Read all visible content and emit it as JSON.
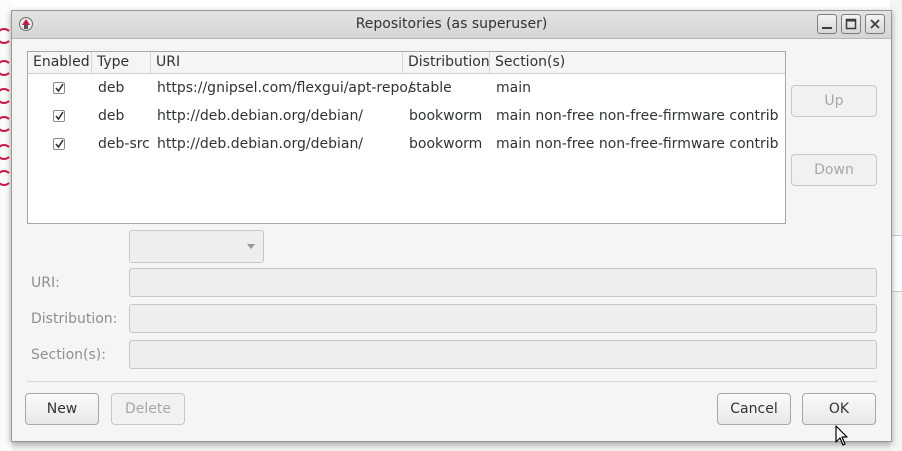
{
  "window": {
    "title": "Repositories (as superuser)"
  },
  "table": {
    "columns": [
      "Enabled",
      "Type",
      "URI",
      "Distribution",
      "Section(s)"
    ],
    "rows": [
      {
        "enabled": true,
        "type": "deb",
        "uri": "https://gnipsel.com/flexgui/apt-repo/",
        "distribution": "stable",
        "sections": "main"
      },
      {
        "enabled": true,
        "type": "deb",
        "uri": "http://deb.debian.org/debian/",
        "distribution": "bookworm",
        "sections": "main non-free non-free-firmware contrib"
      },
      {
        "enabled": true,
        "type": "deb-src",
        "uri": "http://deb.debian.org/debian/",
        "distribution": "bookworm",
        "sections": "main non-free non-free-firmware contrib"
      }
    ]
  },
  "side_buttons": {
    "up": "Up",
    "down": "Down"
  },
  "form": {
    "type_value": "",
    "uri_label": "URI:",
    "uri_value": "",
    "distribution_label": "Distribution:",
    "distribution_value": "",
    "sections_label": "Section(s):",
    "sections_value": ""
  },
  "footer": {
    "new": "New",
    "delete": "Delete",
    "cancel": "Cancel",
    "ok": "OK"
  },
  "colors": {
    "accent": "#c9184a",
    "disabled_text": "#a7a7a5"
  }
}
